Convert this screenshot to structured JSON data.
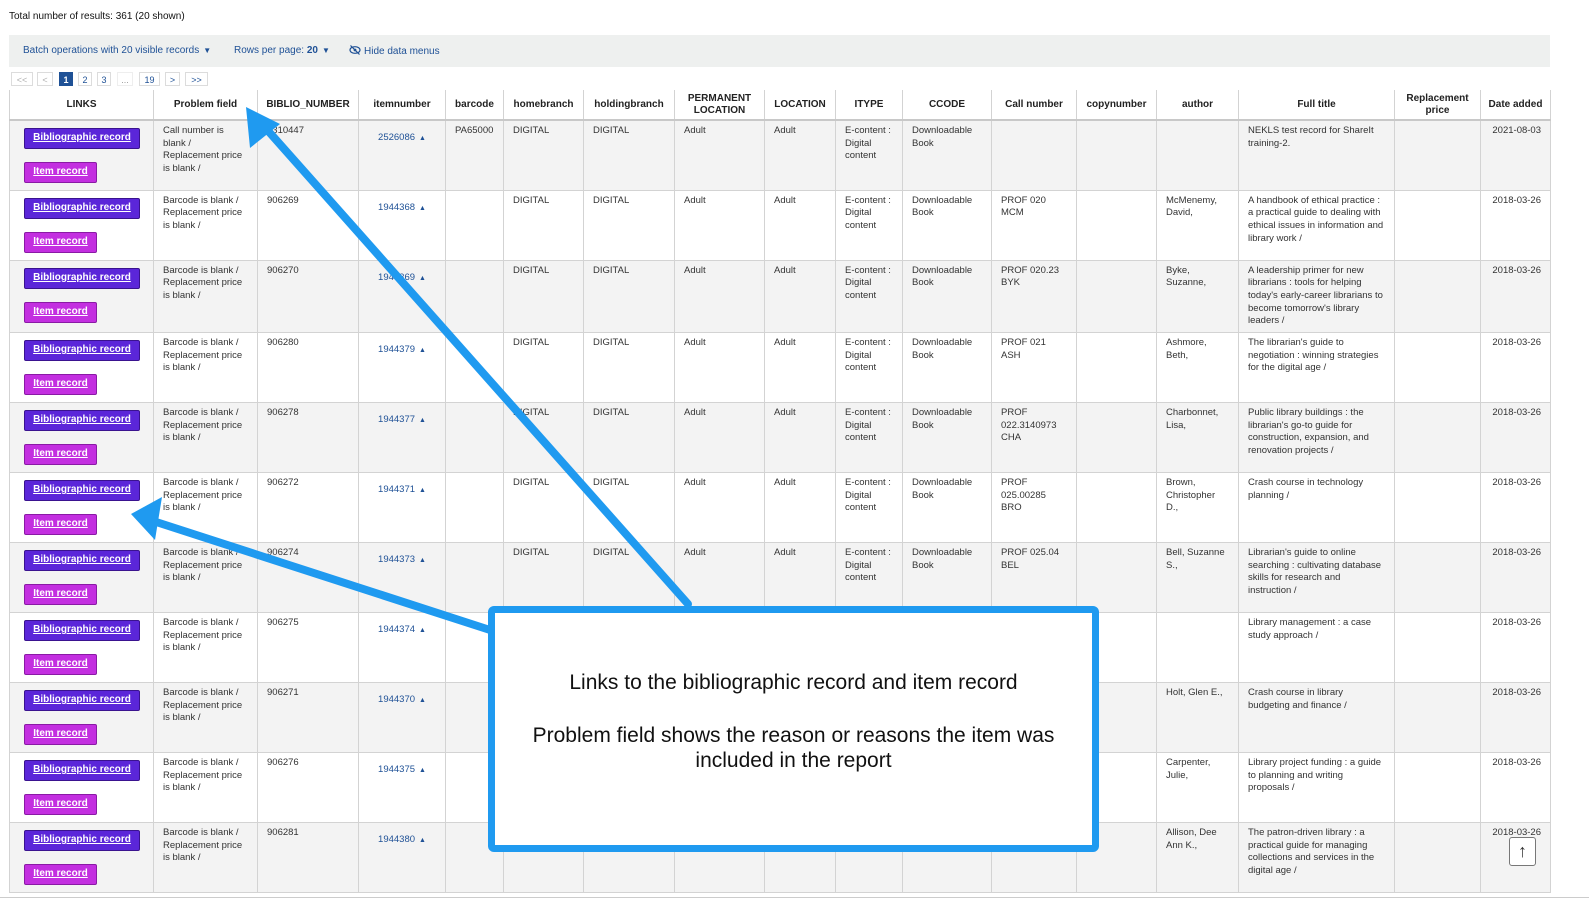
{
  "summary": {
    "total_results": "Total number of results: 361 (20 shown)"
  },
  "toolbar": {
    "batch_label": "Batch operations with 20 visible records",
    "rows_label": "Rows per page:",
    "rows_value": "20",
    "hide_label": "Hide data menus"
  },
  "pagination": {
    "first": "<<",
    "prev": "<",
    "p1": "1",
    "p2": "2",
    "p3": "3",
    "ellipsis": "...",
    "last_page": "19",
    "next": ">",
    "last": ">>"
  },
  "columns": [
    "LINKS",
    "Problem field",
    "BIBLIO_NUMBER",
    "itemnumber",
    "barcode",
    "homebranch",
    "holdingbranch",
    "PERMANENT LOCATION",
    "LOCATION",
    "ITYPE",
    "CCODE",
    "Call number",
    "copynumber",
    "author",
    "Full title",
    "Replacement price",
    "Date added"
  ],
  "links": {
    "bib_label": "Bibliographic record",
    "item_label": "Item record"
  },
  "rows": [
    {
      "problem": "Call number is blank / Replacement price is blank /",
      "biblio": "1310447",
      "itemnumber": "2526086",
      "barcode": "PA65000",
      "homebranch": "DIGITAL",
      "holdingbranch": "DIGITAL",
      "permanent_location": "Adult",
      "location": "Adult",
      "itype": "E-content : Digital content",
      "ccode": "Downloadable Book",
      "callnumber": "",
      "copynumber": "",
      "author": "",
      "title": "NEKLS test record for ShareIt training-2.",
      "price": "",
      "date": "2021-08-03"
    },
    {
      "problem": "Barcode is blank / Replacement price is blank /",
      "biblio": "906269",
      "itemnumber": "1944368",
      "barcode": "",
      "homebranch": "DIGITAL",
      "holdingbranch": "DIGITAL",
      "permanent_location": "Adult",
      "location": "Adult",
      "itype": "E-content : Digital content",
      "ccode": "Downloadable Book",
      "callnumber": "PROF 020 MCM",
      "copynumber": "",
      "author": "McMenemy, David,",
      "title": "A handbook of ethical practice : a practical guide to dealing with ethical issues in information and library work /",
      "price": "",
      "date": "2018-03-26"
    },
    {
      "problem": "Barcode is blank / Replacement price is blank /",
      "biblio": "906270",
      "itemnumber": "1944369",
      "barcode": "",
      "homebranch": "DIGITAL",
      "holdingbranch": "DIGITAL",
      "permanent_location": "Adult",
      "location": "Adult",
      "itype": "E-content : Digital content",
      "ccode": "Downloadable Book",
      "callnumber": "PROF 020.23 BYK",
      "copynumber": "",
      "author": "Byke, Suzanne,",
      "title": "A leadership primer for new librarians : tools for helping today's early-career librarians to become tomorrow's library leaders /",
      "price": "",
      "date": "2018-03-26"
    },
    {
      "problem": "Barcode is blank / Replacement price is blank /",
      "biblio": "906280",
      "itemnumber": "1944379",
      "barcode": "",
      "homebranch": "DIGITAL",
      "holdingbranch": "DIGITAL",
      "permanent_location": "Adult",
      "location": "Adult",
      "itype": "E-content : Digital content",
      "ccode": "Downloadable Book",
      "callnumber": "PROF 021 ASH",
      "copynumber": "",
      "author": "Ashmore, Beth,",
      "title": "The librarian's guide to negotiation : winning strategies for the digital age /",
      "price": "",
      "date": "2018-03-26"
    },
    {
      "problem": "Barcode is blank / Replacement price is blank /",
      "biblio": "906278",
      "itemnumber": "1944377",
      "barcode": "",
      "homebranch": "DIGITAL",
      "holdingbranch": "DIGITAL",
      "permanent_location": "Adult",
      "location": "Adult",
      "itype": "E-content : Digital content",
      "ccode": "Downloadable Book",
      "callnumber": "PROF 022.3140973 CHA",
      "copynumber": "",
      "author": "Charbonnet, Lisa,",
      "title": "Public library buildings : the librarian's go-to guide for construction, expansion, and renovation projects /",
      "price": "",
      "date": "2018-03-26"
    },
    {
      "problem": "Barcode is blank / Replacement price is blank /",
      "biblio": "906272",
      "itemnumber": "1944371",
      "barcode": "",
      "homebranch": "DIGITAL",
      "holdingbranch": "DIGITAL",
      "permanent_location": "Adult",
      "location": "Adult",
      "itype": "E-content : Digital content",
      "ccode": "Downloadable Book",
      "callnumber": "PROF 025.00285 BRO",
      "copynumber": "",
      "author": "Brown, Christopher D.,",
      "title": "Crash course in technology planning /",
      "price": "",
      "date": "2018-03-26"
    },
    {
      "problem": "Barcode is blank / Replacement price is blank /",
      "biblio": "906274",
      "itemnumber": "1944373",
      "barcode": "",
      "homebranch": "DIGITAL",
      "holdingbranch": "DIGITAL",
      "permanent_location": "Adult",
      "location": "Adult",
      "itype": "E-content : Digital content",
      "ccode": "Downloadable Book",
      "callnumber": "PROF 025.04 BEL",
      "copynumber": "",
      "author": "Bell, Suzanne S.,",
      "title": "Librarian's guide to online searching : cultivating database skills for research and instruction /",
      "price": "",
      "date": "2018-03-26"
    },
    {
      "problem": "Barcode is blank / Replacement price is blank /",
      "biblio": "906275",
      "itemnumber": "1944374",
      "barcode": "",
      "homebranch": "",
      "holdingbranch": "",
      "permanent_location": "",
      "location": "",
      "itype": "",
      "ccode": "",
      "callnumber": "",
      "copynumber": "",
      "author": "",
      "title": "Library management : a case study approach /",
      "price": "",
      "date": "2018-03-26"
    },
    {
      "problem": "Barcode is blank / Replacement price is blank /",
      "biblio": "906271",
      "itemnumber": "1944370",
      "barcode": "",
      "homebranch": "",
      "holdingbranch": "",
      "permanent_location": "",
      "location": "",
      "itype": "",
      "ccode": "",
      "callnumber": "",
      "copynumber": "",
      "author": "Holt, Glen E.,",
      "title": "Crash course in library budgeting and finance /",
      "price": "",
      "date": "2018-03-26"
    },
    {
      "problem": "Barcode is blank / Replacement price is blank /",
      "biblio": "906276",
      "itemnumber": "1944375",
      "barcode": "",
      "homebranch": "",
      "holdingbranch": "",
      "permanent_location": "",
      "location": "",
      "itype": "",
      "ccode": "",
      "callnumber": "",
      "copynumber": "",
      "author": "Carpenter, Julie,",
      "title": "Library project funding : a guide to planning and writing proposals /",
      "price": "",
      "date": "2018-03-26"
    },
    {
      "problem": "Barcode is blank / Replacement price is blank /",
      "biblio": "906281",
      "itemnumber": "1944380",
      "barcode": "",
      "homebranch": "",
      "holdingbranch": "",
      "permanent_location": "",
      "location": "",
      "itype": "content",
      "ccode": "",
      "callnumber": "",
      "copynumber": "",
      "author": "Allison, Dee Ann K.,",
      "title": "The patron-driven library : a practical guide for managing collections and services in the digital age /",
      "price": "",
      "date": "2018-03-26"
    }
  ],
  "callout": {
    "line1": "Links to the bibliographic record and item record",
    "line2": "Problem field shows the reason or reasons the item was included in the report"
  },
  "colors": {
    "accent": "#1f5196",
    "bib_button": "#5b26d9",
    "item_button": "#c32fe0",
    "annotation": "#1f9af0"
  },
  "icons": {
    "hide": "eye-slash-icon",
    "sort": "caret-up-icon",
    "scroll_top": "arrow-up-icon"
  }
}
